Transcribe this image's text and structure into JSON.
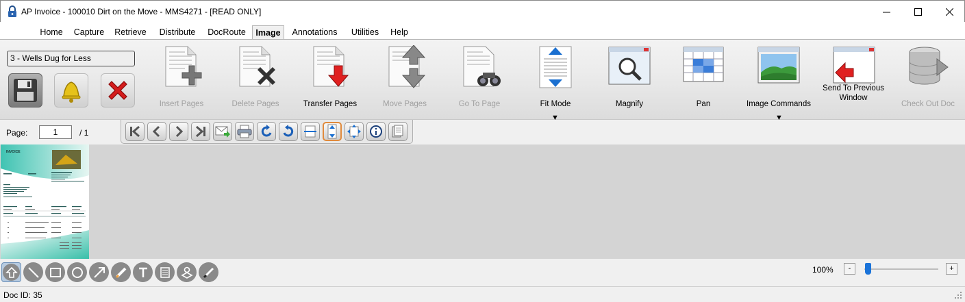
{
  "window": {
    "title": "AP Invoice - 100010 Dirt on the Move - MMS4271 -  [READ ONLY]",
    "minimize_symbol": "—",
    "maximize_symbol": "☐",
    "close_symbol": "✕"
  },
  "menu": {
    "items": [
      "Home",
      "Capture",
      "Retrieve",
      "Distribute",
      "DocRoute",
      "Image",
      "Annotations",
      "Utilities",
      "Help"
    ],
    "active": "Image"
  },
  "ribbon": {
    "vendor_selection": "3 - Wells Dug for Less",
    "left_buttons": [
      {
        "name": "save-icon"
      },
      {
        "name": "bell-icon"
      },
      {
        "name": "delete-x-icon"
      }
    ],
    "buttons": [
      {
        "label": "Insert Pages",
        "enabled": false,
        "icon": "insert-pages-icon"
      },
      {
        "label": "Delete Pages",
        "enabled": false,
        "icon": "delete-pages-icon"
      },
      {
        "label": "Transfer Pages",
        "enabled": true,
        "icon": "transfer-pages-icon"
      },
      {
        "label": "Move Pages",
        "enabled": false,
        "icon": "move-pages-icon"
      },
      {
        "label": "Go To Page",
        "enabled": false,
        "icon": "go-to-page-icon"
      },
      {
        "label": "Fit Mode",
        "enabled": true,
        "icon": "fit-mode-icon",
        "dropdown": true
      },
      {
        "label": "Magnify",
        "enabled": true,
        "icon": "magnify-icon"
      },
      {
        "label": "Pan",
        "enabled": true,
        "icon": "pan-icon"
      },
      {
        "label": "Image Commands",
        "enabled": true,
        "icon": "image-commands-icon",
        "dropdown": true
      },
      {
        "label_line1": "Send To Previous",
        "label_line2": "Window",
        "enabled": true,
        "icon": "send-to-previous-window-icon"
      },
      {
        "label": "Check Out Doc",
        "enabled": false,
        "icon": "check-out-doc-icon"
      }
    ],
    "dropdown_symbol": "▼"
  },
  "page_nav": {
    "label": "Page:",
    "current": "1",
    "total": "/ 1"
  },
  "nav_toolbar": {
    "buttons": [
      "first-page-icon",
      "previous-page-icon",
      "next-page-icon",
      "last-page-icon",
      "email-icon",
      "print-icon",
      "rotate-left-icon",
      "rotate-right-icon",
      "fit-width-icon",
      "fit-height-icon",
      "fit-page-icon",
      "info-icon",
      "page-properties-icon"
    ],
    "selected": "fit-height-icon"
  },
  "thumbnail": {
    "heading": "INVOICE"
  },
  "annotations": {
    "tools": [
      "pointer-icon",
      "line-icon",
      "rectangle-icon",
      "ellipse-icon",
      "arrow-icon",
      "highlighter-icon",
      "text-icon",
      "note-icon",
      "stamp-icon",
      "pen-icon"
    ],
    "selected": "pointer-icon"
  },
  "zoom": {
    "label": "100%",
    "minus": "-",
    "plus": "+",
    "level": 0.02
  },
  "status": {
    "doc_id": "Doc ID: 35"
  }
}
